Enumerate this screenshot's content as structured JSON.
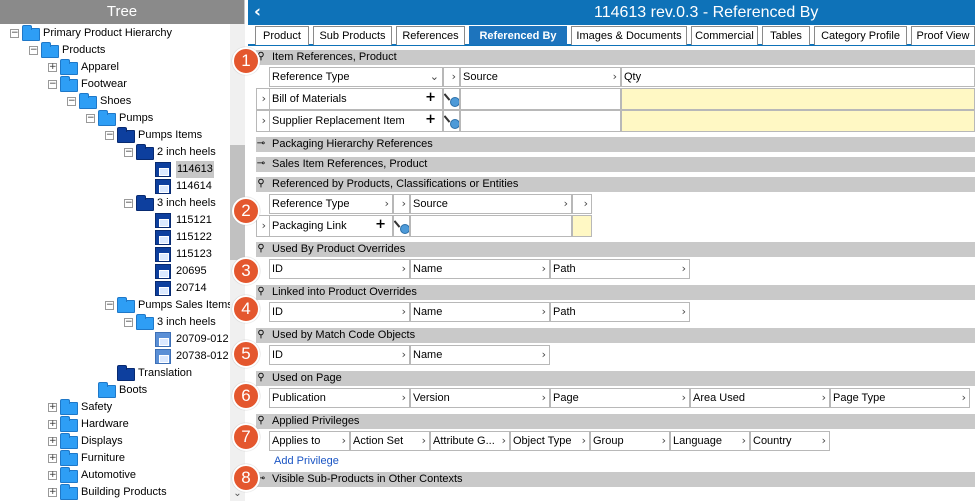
{
  "tree": {
    "header": "Tree",
    "items": [
      {
        "label": "Primary Product Hierarchy",
        "level": 0,
        "toggle": "−",
        "icon": "folder"
      },
      {
        "label": "Products",
        "level": 1,
        "toggle": "−",
        "icon": "folder"
      },
      {
        "label": "Apparel",
        "level": 2,
        "toggle": "+",
        "icon": "folder"
      },
      {
        "label": "Footwear",
        "level": 2,
        "toggle": "−",
        "icon": "folder"
      },
      {
        "label": "Shoes",
        "level": 3,
        "toggle": "−",
        "icon": "folder"
      },
      {
        "label": "Pumps",
        "level": 4,
        "toggle": "−",
        "icon": "folder"
      },
      {
        "label": "Pumps Items",
        "level": 5,
        "toggle": "−",
        "icon": "folder-dark"
      },
      {
        "label": "2 inch heels",
        "level": 6,
        "toggle": "−",
        "icon": "folder-dark"
      },
      {
        "label": "114613",
        "level": 7,
        "toggle": "",
        "icon": "product",
        "selected": true
      },
      {
        "label": "114614",
        "level": 7,
        "toggle": "",
        "icon": "product"
      },
      {
        "label": "3 inch heels",
        "level": 6,
        "toggle": "−",
        "icon": "folder-dark"
      },
      {
        "label": "115121",
        "level": 7,
        "toggle": "",
        "icon": "product"
      },
      {
        "label": "115122",
        "level": 7,
        "toggle": "",
        "icon": "product"
      },
      {
        "label": "115123",
        "level": 7,
        "toggle": "",
        "icon": "product"
      },
      {
        "label": "20695",
        "level": 7,
        "toggle": "",
        "icon": "product"
      },
      {
        "label": "20714",
        "level": 7,
        "toggle": "",
        "icon": "product"
      },
      {
        "label": "Pumps Sales Items",
        "level": 5,
        "toggle": "−",
        "icon": "folder"
      },
      {
        "label": "3 inch heels",
        "level": 6,
        "toggle": "−",
        "icon": "folder"
      },
      {
        "label": "20709-012",
        "level": 7,
        "toggle": "",
        "icon": "product-light"
      },
      {
        "label": "20738-012",
        "level": 7,
        "toggle": "",
        "icon": "product-light"
      },
      {
        "label": "Translation",
        "level": 5,
        "toggle": "",
        "icon": "folder-dark"
      },
      {
        "label": "Boots",
        "level": 4,
        "toggle": "",
        "icon": "folder"
      },
      {
        "label": "Safety",
        "level": 2,
        "toggle": "+",
        "icon": "folder"
      },
      {
        "label": "Hardware",
        "level": 2,
        "toggle": "+",
        "icon": "folder"
      },
      {
        "label": "Displays",
        "level": 2,
        "toggle": "+",
        "icon": "folder"
      },
      {
        "label": "Furniture",
        "level": 2,
        "toggle": "+",
        "icon": "folder"
      },
      {
        "label": "Automotive",
        "level": 2,
        "toggle": "+",
        "icon": "folder"
      },
      {
        "label": "Building Products",
        "level": 2,
        "toggle": "+",
        "icon": "folder"
      }
    ]
  },
  "header": {
    "title": "114613 rev.0.3 - Referenced By",
    "back_icon": "chevron-left-icon"
  },
  "tabs": [
    {
      "label": "Product"
    },
    {
      "label": "Sub Products"
    },
    {
      "label": "References"
    },
    {
      "label": "Referenced By",
      "active": true
    },
    {
      "label": "Images & Documents"
    },
    {
      "label": "Commercial"
    },
    {
      "label": "Tables"
    },
    {
      "label": "Category Profile"
    },
    {
      "label": "Proof View"
    }
  ],
  "sections": {
    "item_refs": {
      "title": "Item References, Product",
      "columns": [
        "Reference Type",
        "Source",
        "Qty"
      ],
      "rows": [
        "Bill of Materials",
        "Supplier Replacement Item"
      ]
    },
    "packaging": {
      "title": "Packaging Hierarchy References"
    },
    "sales": {
      "title": "Sales Item References, Product"
    },
    "referenced_by": {
      "title": "Referenced by Products, Classifications or Entities",
      "columns": [
        "Reference Type",
        "Source"
      ],
      "rows": [
        "Packaging Link"
      ]
    },
    "used_overrides": {
      "title": "Used By Product Overrides",
      "columns": [
        "ID",
        "Name",
        "Path"
      ]
    },
    "linked_overrides": {
      "title": "Linked into Product Overrides",
      "columns": [
        "ID",
        "Name",
        "Path"
      ]
    },
    "match_code": {
      "title": "Used by Match Code Objects",
      "columns": [
        "ID",
        "Name"
      ]
    },
    "used_page": {
      "title": "Used on Page",
      "columns": [
        "Publication",
        "Version",
        "Page",
        "Area Used",
        "Page Type"
      ]
    },
    "privileges": {
      "title": "Applied Privileges",
      "columns": [
        "Applies to",
        "Action Set",
        "Attribute G...",
        "Object Type",
        "Group",
        "Language",
        "Country"
      ],
      "add_label": "Add Privilege"
    },
    "visible_sub": {
      "title": "Visible Sub-Products in Other Contexts"
    }
  },
  "badges": [
    "1",
    "2",
    "3",
    "4",
    "5",
    "6",
    "7",
    "8"
  ],
  "colors": {
    "title_bar": "#0e72b8",
    "active_tab": "#1d74bd",
    "section_bg": "#c9c9c9",
    "badge": "#e4572e",
    "qty_bg": "#fff8c4",
    "tree_header": "#8a8a8a"
  }
}
